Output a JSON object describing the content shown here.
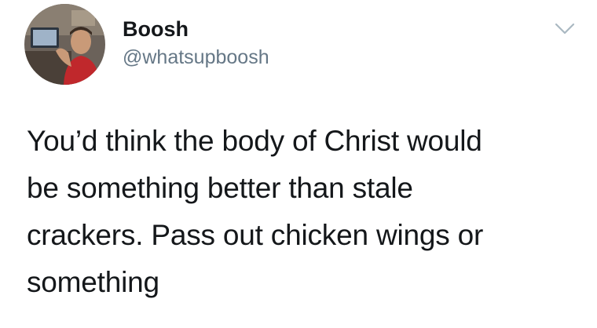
{
  "tweet": {
    "author": {
      "display_name": "Boosh",
      "handle": "@whatsupboosh",
      "avatar_icon": "profile-photo"
    },
    "menu_icon": "chevron-down-icon",
    "text": "You’d think the body of Christ would\nbe something better than stale\ncrackers. Pass out chicken wings or\nsomething"
  },
  "colors": {
    "text": "#14171a",
    "handle": "#657786",
    "chevron": "#aab8c2",
    "background": "#ffffff"
  }
}
